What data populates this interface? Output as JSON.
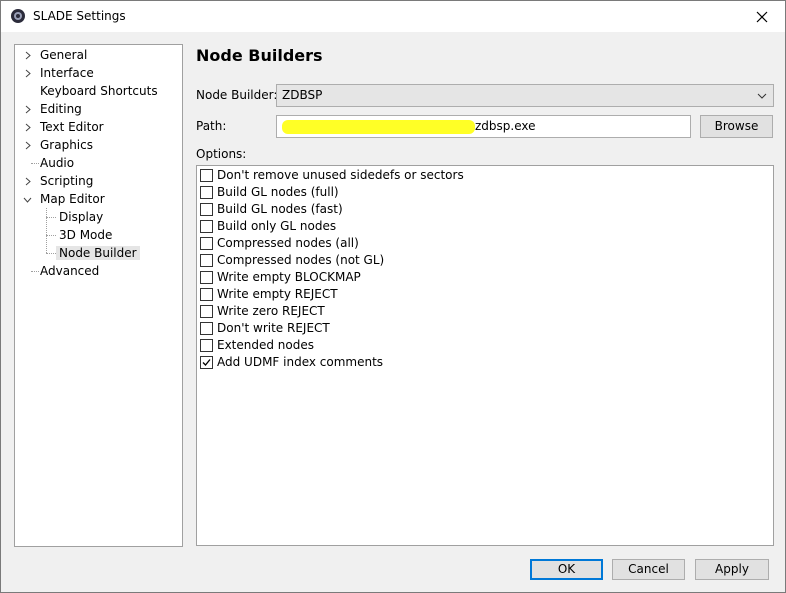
{
  "window": {
    "title": "SLADE Settings"
  },
  "sidebar": {
    "items": [
      {
        "label": "General",
        "expandable": true
      },
      {
        "label": "Interface",
        "expandable": true
      },
      {
        "label": "Keyboard Shortcuts",
        "expandable": false
      },
      {
        "label": "Editing",
        "expandable": true
      },
      {
        "label": "Text Editor",
        "expandable": true
      },
      {
        "label": "Graphics",
        "expandable": true
      },
      {
        "label": "Audio",
        "expandable": false
      },
      {
        "label": "Scripting",
        "expandable": true
      },
      {
        "label": "Map Editor",
        "expanded": true
      },
      {
        "label": "Display",
        "child": true
      },
      {
        "label": "3D Mode",
        "child": true
      },
      {
        "label": "Node Builder",
        "child": true,
        "selected": true
      },
      {
        "label": "Advanced",
        "expandable": false
      }
    ]
  },
  "main": {
    "heading": "Node Builders",
    "node_builder_label": "Node Builder:",
    "node_builder_value": "ZDBSP",
    "path_label": "Path:",
    "path_value": "C:\\...\\zdbsp.exe",
    "path_visible_suffix": "zdbsp.exe",
    "browse_label": "Browse",
    "options_label": "Options:",
    "options": [
      {
        "label": "Don't remove unused sidedefs or sectors",
        "checked": false
      },
      {
        "label": "Build GL nodes (full)",
        "checked": false
      },
      {
        "label": "Build GL nodes (fast)",
        "checked": false
      },
      {
        "label": "Build only GL nodes",
        "checked": false
      },
      {
        "label": "Compressed nodes (all)",
        "checked": false
      },
      {
        "label": "Compressed nodes (not GL)",
        "checked": false
      },
      {
        "label": "Write empty BLOCKMAP",
        "checked": false
      },
      {
        "label": "Write empty REJECT",
        "checked": false
      },
      {
        "label": "Write zero REJECT",
        "checked": false
      },
      {
        "label": "Don't write REJECT",
        "checked": false
      },
      {
        "label": "Extended nodes",
        "checked": false
      },
      {
        "label": "Add UDMF index comments",
        "checked": true
      }
    ]
  },
  "footer": {
    "ok_label": "OK",
    "cancel_label": "Cancel",
    "apply_label": "Apply"
  },
  "colors": {
    "focus_border": "#0078d7",
    "selected_bg": "#e5e5e5",
    "redaction": "#ffff00"
  }
}
